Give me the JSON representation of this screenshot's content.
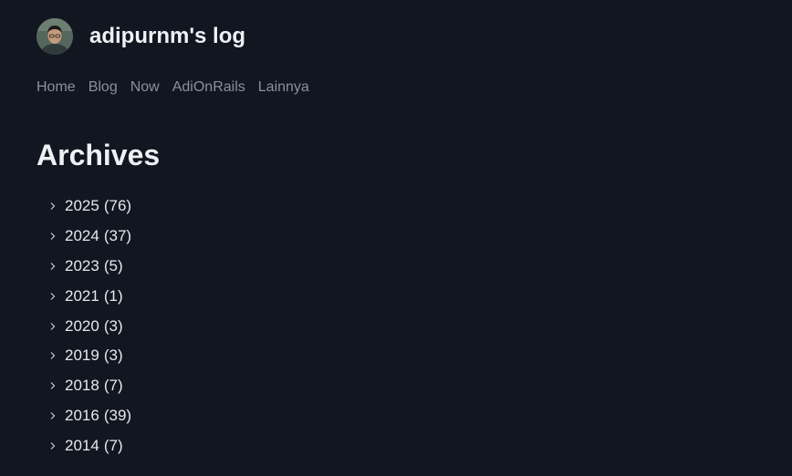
{
  "site": {
    "title": "adipurnm's log"
  },
  "nav": {
    "items": [
      {
        "label": "Home"
      },
      {
        "label": "Blog"
      },
      {
        "label": "Now"
      },
      {
        "label": "AdiOnRails"
      },
      {
        "label": "Lainnya"
      }
    ]
  },
  "main": {
    "title": "Archives",
    "archives": [
      {
        "year": "2025",
        "count": "(76)"
      },
      {
        "year": "2024",
        "count": "(37)"
      },
      {
        "year": "2023",
        "count": "(5)"
      },
      {
        "year": "2021",
        "count": "(1)"
      },
      {
        "year": "2020",
        "count": "(3)"
      },
      {
        "year": "2019",
        "count": "(3)"
      },
      {
        "year": "2018",
        "count": "(7)"
      },
      {
        "year": "2016",
        "count": "(39)"
      },
      {
        "year": "2014",
        "count": "(7)"
      }
    ]
  },
  "icons": {
    "archive_toggle": "chevron-right-icon"
  },
  "colors": {
    "background": "#121621",
    "text_primary": "#eef0f4",
    "text_muted": "#8b909c"
  }
}
